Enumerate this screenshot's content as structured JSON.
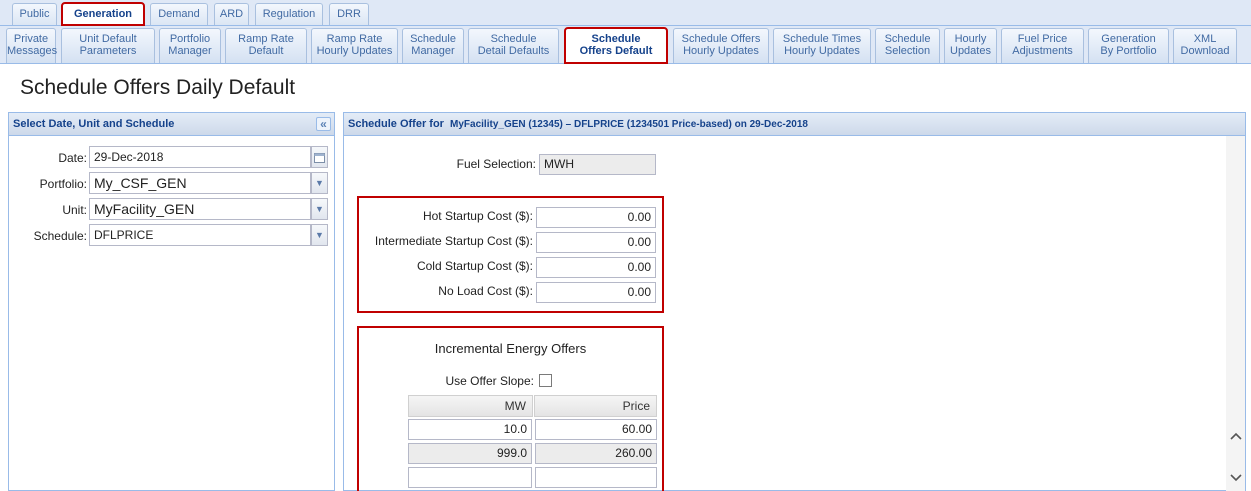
{
  "top_tabs": [
    "Public",
    "Generation",
    "Demand",
    "ARD",
    "Regulation",
    "DRR"
  ],
  "sub_tabs": [
    [
      "Private",
      "Messages"
    ],
    [
      "Unit Default",
      "Parameters"
    ],
    [
      "Portfolio",
      "Manager"
    ],
    [
      "Ramp Rate",
      "Default"
    ],
    [
      "Ramp Rate",
      "Hourly Updates"
    ],
    [
      "Schedule",
      "Manager"
    ],
    [
      "Schedule",
      "Detail Defaults"
    ],
    [
      "Schedule",
      "Offers Default"
    ],
    [
      "Schedule Offers",
      "Hourly Updates"
    ],
    [
      "Schedule Times",
      "Hourly Updates"
    ],
    [
      "Schedule",
      "Selection"
    ],
    [
      "Hourly",
      "Updates"
    ],
    [
      "Fuel Price",
      "Adjustments"
    ],
    [
      "Generation",
      "By Portfolio"
    ],
    [
      "XML",
      "Download"
    ]
  ],
  "page_title": "Schedule Offers Daily Default",
  "left_panel": {
    "title": "Select Date, Unit and Schedule",
    "date_label": "Date:",
    "date_value": "29-Dec-2018",
    "portfolio_label": "Portfolio:",
    "portfolio_value": "My_CSF_GEN",
    "unit_label": "Unit:",
    "unit_value": "MyFacility_GEN",
    "schedule_label": "Schedule:",
    "schedule_value": "DFLPRICE"
  },
  "right_panel": {
    "title_prefix": "Schedule Offer for",
    "title_detail": "MyFacility_GEN (12345) – DFLPRICE (1234501 Price-based) on 29-Dec-2018",
    "fuel_label": "Fuel Selection:",
    "fuel_value": "MWH",
    "costs": [
      {
        "label": "Hot Startup Cost ($):",
        "value": "0.00"
      },
      {
        "label": "Intermediate Startup Cost ($):",
        "value": "0.00"
      },
      {
        "label": "Cold Startup Cost ($):",
        "value": "0.00"
      },
      {
        "label": "No Load Cost ($):",
        "value": "0.00"
      }
    ],
    "offers_title": "Incremental Energy Offers",
    "slope_label": "Use Offer Slope:",
    "grid_headers": [
      "MW",
      "Price"
    ],
    "grid_rows": [
      [
        "10.0",
        "60.00"
      ],
      [
        "999.0",
        "260.00"
      ],
      [
        "",
        ""
      ]
    ]
  }
}
